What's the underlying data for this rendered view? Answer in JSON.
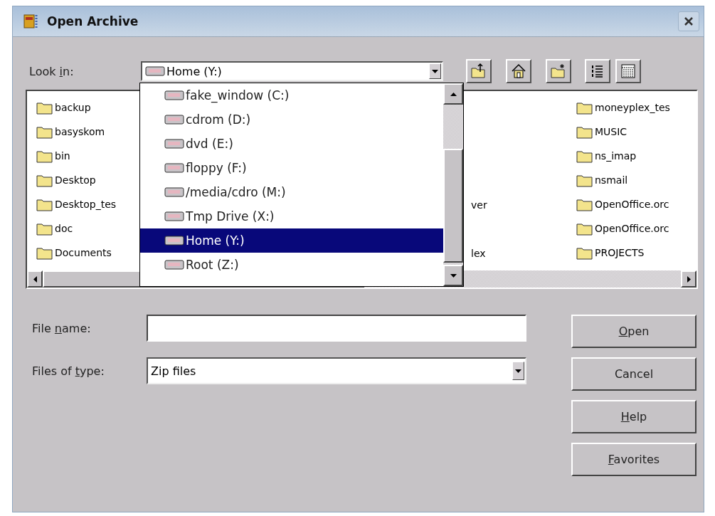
{
  "window": {
    "title": "Open Archive"
  },
  "look_in": {
    "label": [
      {
        "text": "Look ",
        "underlined": false
      },
      {
        "text": "i",
        "underlined": true
      },
      {
        "text": "n:",
        "underlined": false
      }
    ],
    "value": "Home (Y:)",
    "expanded": true
  },
  "drive_menu": {
    "items": [
      {
        "text": "fake_window (C:)",
        "selected": false
      },
      {
        "text": "cdrom (D:)",
        "selected": false
      },
      {
        "text": "dvd (E:)",
        "selected": false
      },
      {
        "text": "floppy (F:)",
        "selected": false
      },
      {
        "text": "/media/cdro (M:)",
        "selected": false
      },
      {
        "text": "Tmp Drive (X:)",
        "selected": false
      },
      {
        "text": "Home (Y:)",
        "selected": true
      },
      {
        "text": "Root (Z:)",
        "selected": false
      }
    ]
  },
  "file_list": {
    "rows": [
      {
        "column_1": "backup",
        "column_3": "moneyplex_tes"
      },
      {
        "column_1": "basyskom",
        "column_3": "MUSIC"
      },
      {
        "column_1": "bin",
        "column_3": "ns_imap"
      },
      {
        "column_1": "Desktop",
        "column_3": "nsmail"
      },
      {
        "column_1": "Desktop_tes",
        "column_2": "ver",
        "column_3": "OpenOffice.orc"
      },
      {
        "column_1": "doc",
        "column_3": "OpenOffice.orc"
      },
      {
        "column_1": "Documents",
        "column_2": "lex",
        "column_3": "PROJECTS"
      }
    ]
  },
  "file_name": {
    "label": [
      {
        "text": "File ",
        "underlined": false
      },
      {
        "text": "n",
        "underlined": true
      },
      {
        "text": "ame:",
        "underlined": false
      }
    ]
  },
  "file_type": {
    "label": [
      {
        "text": "Files of ",
        "underlined": false
      },
      {
        "text": "t",
        "underlined": true
      },
      {
        "text": "ype:",
        "underlined": false
      }
    ],
    "value": "Zip files"
  },
  "buttons": [
    {
      "label": [
        {
          "text": "O",
          "underlined": true
        },
        {
          "text": "pen",
          "underlined": false
        }
      ]
    },
    {
      "label": [
        {
          "text": "Cancel",
          "underlined": false
        }
      ]
    },
    {
      "label": [
        {
          "text": "H",
          "underlined": true
        },
        {
          "text": "elp",
          "underlined": false
        }
      ]
    },
    {
      "label": [
        {
          "text": "F",
          "underlined": true
        },
        {
          "text": "avorites",
          "underlined": false
        }
      ]
    }
  ]
}
